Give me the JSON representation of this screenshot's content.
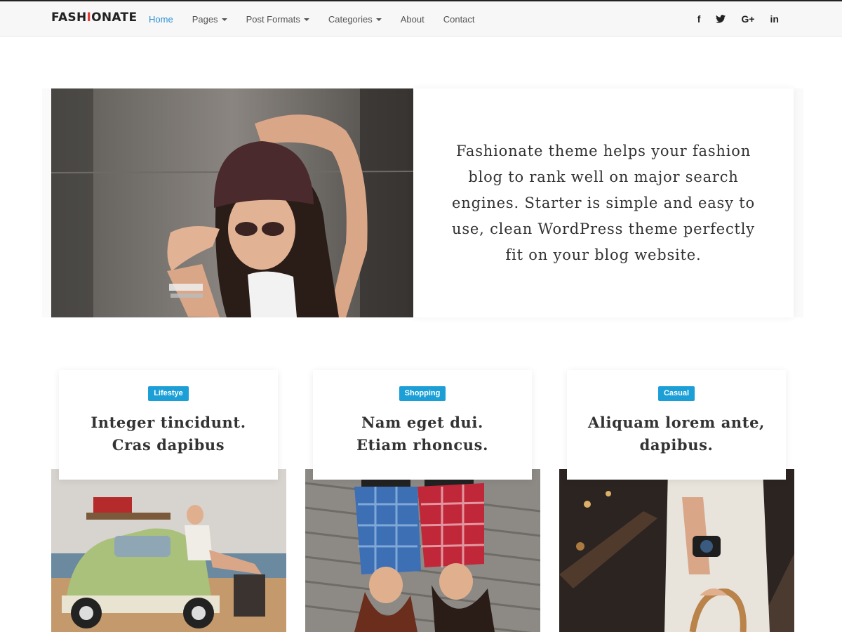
{
  "header": {
    "logo_text_1": "FASH",
    "logo_text_accent": "I",
    "logo_text_2": "ONATE",
    "nav": [
      {
        "label": "Home",
        "active": true
      },
      {
        "label": "Pages",
        "dropdown": true
      },
      {
        "label": "Post Formats",
        "dropdown": true
      },
      {
        "label": "Categories",
        "dropdown": true
      },
      {
        "label": "About"
      },
      {
        "label": "Contact"
      }
    ],
    "social": [
      "facebook-icon",
      "twitter-icon",
      "google-plus-icon",
      "linkedin-icon"
    ],
    "social_labels": {
      "facebook": "f",
      "google_plus": "G+",
      "linkedin": "in"
    }
  },
  "hero": {
    "text": "Fashionate theme helps your fashion blog to rank well on major search engines. Starter is simple and easy to use, clean WordPress theme perfectly fit on your blog website."
  },
  "cards": [
    {
      "category": "Lifestye",
      "title": "Integer tincidunt. Cras dapibus"
    },
    {
      "category": "Shopping",
      "title": "Nam eget dui. Etiam rhoncus."
    },
    {
      "category": "Casual",
      "title": "Aliquam lorem ante, dapibus."
    }
  ],
  "colors": {
    "accent": "#e53935",
    "nav_active": "#2c8fd0",
    "badge": "#1b9fd6",
    "text": "#333333"
  }
}
